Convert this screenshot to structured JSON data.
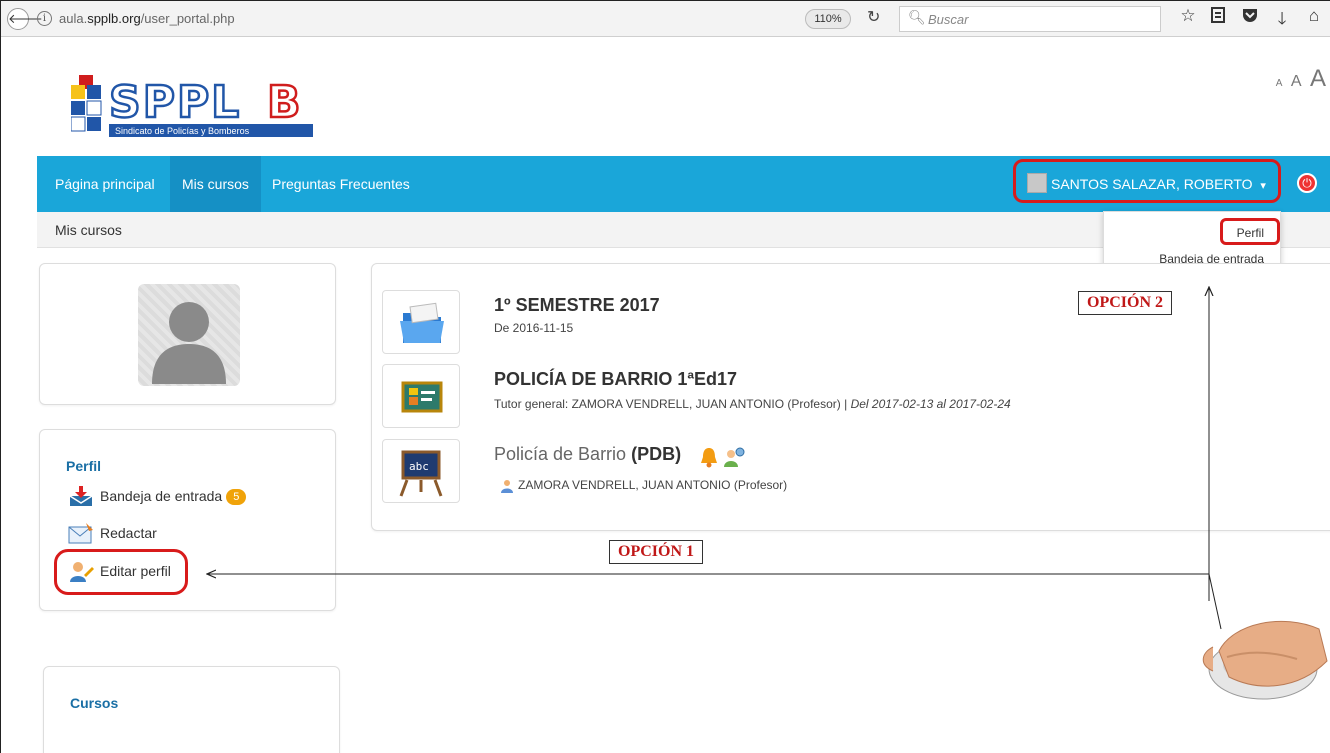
{
  "browser": {
    "url_prefix": "aula.",
    "url_domain": "spplb.org",
    "url_path": "/user_portal.php",
    "zoom": "110%",
    "search_placeholder": "Buscar"
  },
  "logo": {
    "text": "SPPLB",
    "tagline": "Sindicato de Policías y Bomberos"
  },
  "text_size": {
    "small": "A",
    "medium": "A",
    "large": "A"
  },
  "nav": {
    "items": [
      {
        "label": "Página principal"
      },
      {
        "label": "Mis cursos"
      },
      {
        "label": "Preguntas Frecuentes"
      }
    ],
    "user_name": "SANTOS SALAZAR, ROBERTO",
    "caret": "▾"
  },
  "breadcrumb": "Mis cursos",
  "user_dropdown": {
    "profile": "Perfil",
    "inbox": "Bandeja de entrada"
  },
  "sidebar": {
    "profile_title": "Perfil",
    "inbox_label": "Bandeja de entrada",
    "inbox_count": "5",
    "compose_label": "Redactar",
    "edit_profile_label": "Editar perfil",
    "courses_title": "Cursos"
  },
  "courses": [
    {
      "title": "1º SEMESTRE 2017",
      "subtitle": "De 2016-11-15"
    },
    {
      "title": "POLICÍA DE BARRIO 1ªEd17",
      "subtitle_plain": "Tutor general: ZAMORA VENDRELL, JUAN ANTONIO (Profesor) | ",
      "subtitle_italic": "Del 2017-02-13 al 2017-02-24"
    },
    {
      "title_plain": "Policía de Barrio ",
      "title_bold": "(PDB)",
      "teacher": "ZAMORA VENDRELL, JUAN ANTONIO (Profesor)"
    }
  ],
  "annotations": {
    "option1": "OPCIÓN 1",
    "option2": "OPCIÓN 2"
  },
  "colors": {
    "nav_bg": "#1aa6d9",
    "nav_active": "#1590c5",
    "annotation_red": "#d81b1b",
    "badge": "#f0a30a",
    "sidebar_title": "#1a6fa5"
  }
}
